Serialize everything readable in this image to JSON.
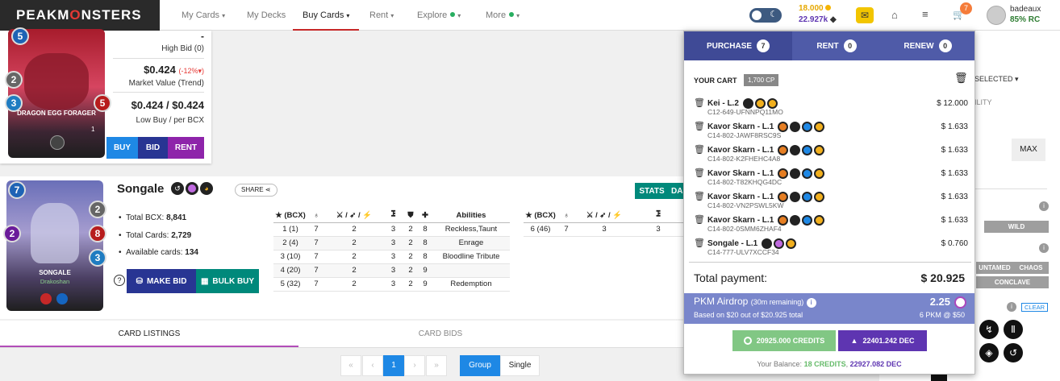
{
  "nav": {
    "logo_a": "PEAKM",
    "logo_o": "O",
    "logo_b": "NSTERS",
    "items": [
      "My Cards",
      "My Decks",
      "Buy Cards",
      "Rent",
      "Explore",
      "More"
    ],
    "balance_credits": "18.000",
    "balance_dec": "22.927k",
    "cart_count": "7",
    "username": "badeaux",
    "rc": "85% RC"
  },
  "card1": {
    "name": "DRAGON EGG FORAGER",
    "mana": "5",
    "level": "1",
    "high_bid_dash": "-",
    "high_bid": "High Bid (0)",
    "market": "$0.424",
    "market_change": "(-12%",
    "market_label": "Market Value (Trend)",
    "low_buy": "$0.424 / $0.424",
    "low_label": "Low Buy / per BCX",
    "buy": "BUY",
    "bid": "BID",
    "rent": "RENT",
    "stats": [
      "2",
      "3",
      "5"
    ]
  },
  "card2": {
    "title": "Songale",
    "name": "SONGALE",
    "tag": "Drakoshan",
    "mana": "7",
    "share": "SHARE",
    "stats": [
      "2",
      "8",
      "3",
      "2"
    ],
    "total_bcx_label": "Total BCX:",
    "total_bcx": "8,841",
    "total_cards_label": "Total Cards:",
    "total_cards": "2,729",
    "available_label": "Available cards:",
    "available": "134",
    "make_bid": "MAKE BID",
    "bulk_buy": "BULK BUY",
    "stats_btn": "STATS",
    "da_btn": "DA"
  },
  "table1": {
    "headers": [
      "★ (BCX)",
      "♁",
      "⚔ / ➶ / ⚡",
      "⯿",
      "⛊",
      "✚",
      "Abilities"
    ],
    "rows": [
      [
        "1 (1)",
        "7",
        "2",
        "3",
        "2",
        "8",
        "Reckless,Taunt"
      ],
      [
        "2 (4)",
        "7",
        "2",
        "3",
        "2",
        "8",
        "Enrage"
      ],
      [
        "3 (10)",
        "7",
        "2",
        "3",
        "2",
        "8",
        "Bloodline Tribute"
      ],
      [
        "4 (20)",
        "7",
        "2",
        "3",
        "2",
        "9",
        ""
      ],
      [
        "5 (32)",
        "7",
        "2",
        "3",
        "2",
        "9",
        "Redemption"
      ]
    ]
  },
  "table2": {
    "headers": [
      "★ (BCX)",
      "♁",
      "⚔ / ➶ / ⚡",
      "⯿"
    ],
    "rows": [
      [
        "6 (46)",
        "7",
        "3",
        "3"
      ]
    ]
  },
  "tabs": {
    "listings": "CARD LISTINGS",
    "bids": "CARD BIDS"
  },
  "pager": {
    "first": "«",
    "prev": "‹",
    "page": "1",
    "next": "›",
    "last": "»",
    "group": "Group",
    "single": "Single"
  },
  "popup": {
    "tabs": [
      {
        "label": "PURCHASE",
        "count": "7"
      },
      {
        "label": "RENT",
        "count": "0"
      },
      {
        "label": "RENEW",
        "count": "0"
      }
    ],
    "your_cart": "YOUR CART",
    "cp": "1,700 CP",
    "items": [
      {
        "name": "Kei - L.2",
        "id": "C12-649-UFNNPQ11MO",
        "price": "$ 12.000"
      },
      {
        "name": "Kavor Skarn - L.1",
        "id": "C14-802-JAWF8RSC9S",
        "price": "$ 1.633"
      },
      {
        "name": "Kavor Skarn - L.1",
        "id": "C14-802-K2FHEHC4A8",
        "price": "$ 1.633"
      },
      {
        "name": "Kavor Skarn - L.1",
        "id": "C14-802-T82KHQG4DC",
        "price": "$ 1.633"
      },
      {
        "name": "Kavor Skarn - L.1",
        "id": "C14-802-VN2PSWL5KW",
        "price": "$ 1.633"
      },
      {
        "name": "Kavor Skarn - L.1",
        "id": "C14-802-0SMM6ZHAF4",
        "price": "$ 1.633"
      },
      {
        "name": "Songale - L.1",
        "id": "C14-777-ULV7XCCF34",
        "price": "$ 0.760"
      }
    ],
    "total_label": "Total payment:",
    "total": "$ 20.925",
    "airdrop": "PKM Airdrop",
    "airdrop_rem": "(30m remaining)",
    "airdrop_val": "2.25",
    "airdrop_sub": "Based on $20 out of $20.925 total",
    "airdrop_rate": "6 PKM @ $50",
    "credits_btn": "20925.000 CREDITS",
    "dec_btn": "22401.242 DEC",
    "balance_label": "Your Balance:",
    "balance_credits": "18 CREDITS",
    "balance_dec": "22927.082 DEC"
  },
  "right": {
    "selected": "SELECTED",
    "ility": "ILITY",
    "max": "MAX",
    "wild": "WILD",
    "untamed": "UNTAMED",
    "chaos": "CHAOS",
    "conclave": "CONCLAVE",
    "clear": "CLEAR"
  },
  "colors": {
    "purple": "#3f4a96",
    "blue": "#1e88e5",
    "navy": "#283593",
    "magenta": "#8e24aa",
    "teal": "#00897b",
    "green": "#66bb6a",
    "violet": "#5e35b1"
  }
}
